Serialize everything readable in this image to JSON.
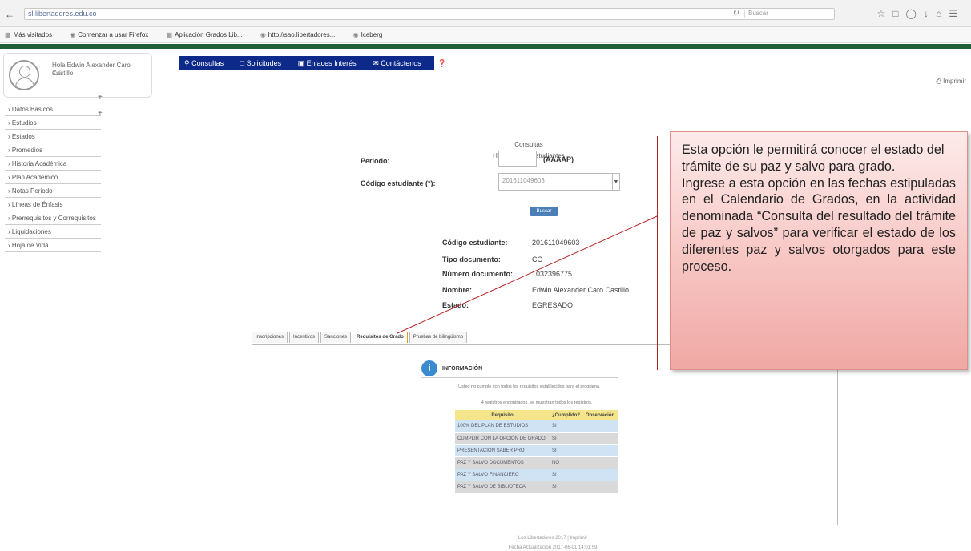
{
  "browser": {
    "url": "sl.libertadores.edu.co",
    "search_placeholder": "Buscar",
    "bookmarks": [
      "Más visitados",
      "Comenzar a usar Firefox",
      "Aplicación Grados Lib...",
      "http://sao.libertadores...",
      "Iceberg"
    ]
  },
  "user": {
    "name": "Hola Edwin Alexander Caro Castillo",
    "role": "Salir"
  },
  "topmenu": {
    "items": [
      "Consultas",
      "Solicitudes",
      "Enlaces Interés",
      "Contáctenos",
      "Ayuda"
    ],
    "print_link": "Imprimir"
  },
  "sidebar": {
    "items": [
      "Datos Básicos",
      "Estudios",
      "Estados",
      "Promedios",
      "Historia Académica",
      "Plan Académico",
      "Notas Periodo",
      "Líneas de Énfasis",
      "Prerrequisitos y Correquisitos",
      "Liquidaciones",
      "Hoja de Vida"
    ]
  },
  "main": {
    "title_line1": "Consultas",
    "title_line2": "Hoja de Vida Estudiantes",
    "periodo_label": "Periodo:",
    "periodo_hint": "(AAAAP)",
    "codigo_label": "Código estudiante (*):",
    "codigo_value": "201611049603",
    "search_button": "Buscar",
    "info": [
      {
        "label": "Código estudiante:",
        "value": "201611049603"
      },
      {
        "label": "Tipo documento:",
        "value": "CC"
      },
      {
        "label": "Número documento:",
        "value": "1032396775"
      },
      {
        "label": "Nombre:",
        "value": "Edwin Alexander Caro Castillo"
      },
      {
        "label": "Estado:",
        "value": "EGRESADO"
      }
    ]
  },
  "tabs": [
    "Inscripciones",
    "Incentivos",
    "Sanciones",
    "Requisitos de Grado",
    "Pruebas de bilingüismo"
  ],
  "requisitos": {
    "header": "INFORMACIÓN",
    "note": "Usted no cumple con todos los requisitos establecidos para el programa",
    "note2": "4 registros encontrados, se muestran todos los registros.",
    "columns": [
      "Requisito",
      "¿Cumplido?",
      "Observación"
    ],
    "rows": [
      {
        "req": "100% DEL PLAN DE ESTUDIOS",
        "ok": "SI",
        "obs": ""
      },
      {
        "req": "CUMPLIR CON LA OPCIÓN DE GRADO",
        "ok": "SI",
        "obs": ""
      },
      {
        "req": "PRESENTACIÓN SABER PRO",
        "ok": "SI",
        "obs": ""
      },
      {
        "req": "PAZ Y SALVO DOCUMENTOS",
        "ok": "NO",
        "obs": ""
      },
      {
        "req": "PAZ Y SALVO FINANCIERO",
        "ok": "SI",
        "obs": ""
      },
      {
        "req": "PAZ Y SALVO DE BIBLIOTECA",
        "ok": "SI",
        "obs": ""
      }
    ]
  },
  "footer": {
    "line1": "Los Libertadores 2017 | Imprimir",
    "line2": "Fecha Actualización 2017-06-01 14:01:59"
  },
  "callout": {
    "paragraph1": "Esta opción le permitirá conocer el estado del trámite de su paz y salvo para grado.",
    "paragraph2": "Ingrese a esta opción en las fechas estipuladas en el Calendario de Grados, en la actividad denominada “Consulta del resultado del trámite de paz y salvos” para verificar el estado de los diferentes paz y salvos otorgados para este proceso."
  }
}
